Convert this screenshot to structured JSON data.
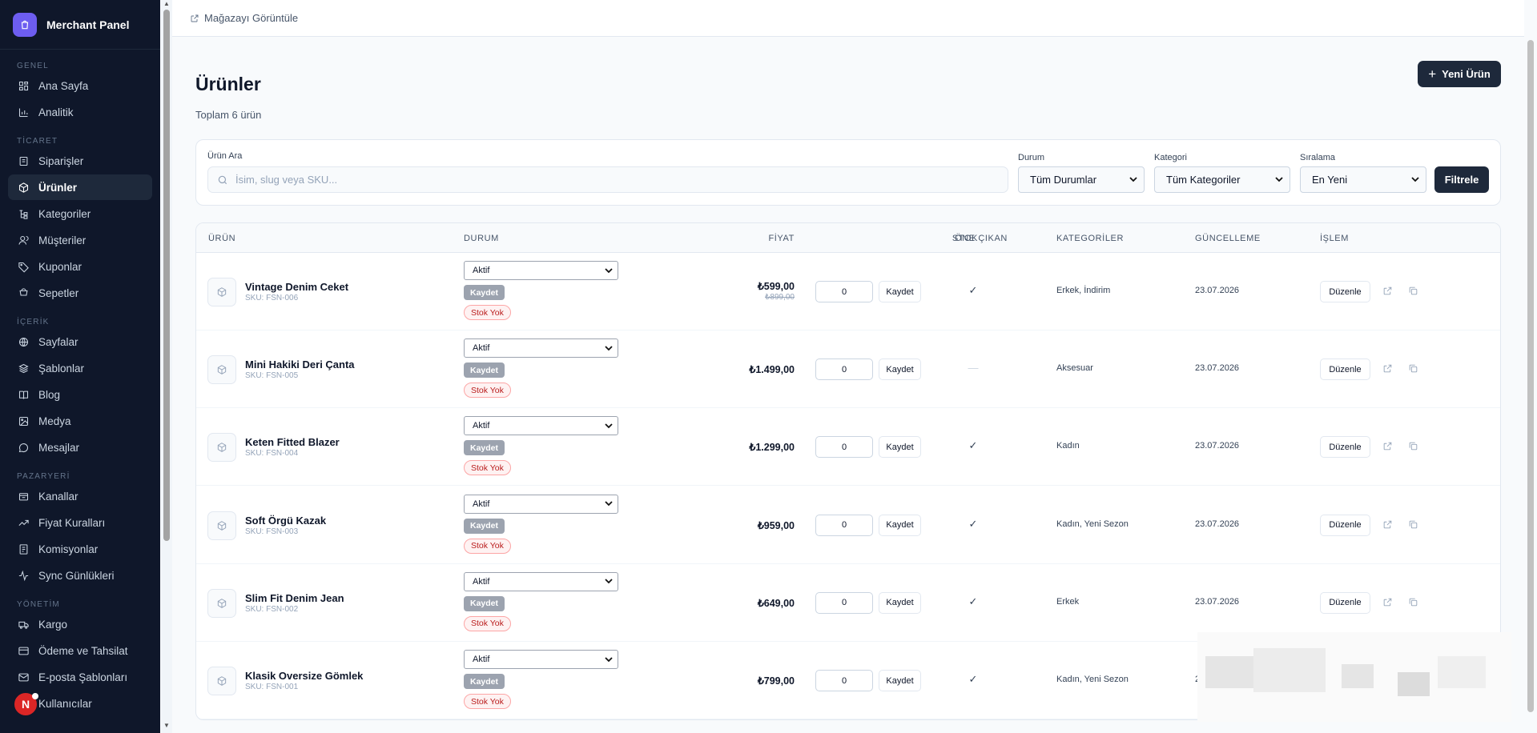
{
  "app": {
    "name": "Merchant Panel"
  },
  "sidebar": {
    "sections": [
      {
        "title": "GENEL",
        "items": [
          {
            "label": "Ana Sayfa",
            "icon": "dashboard-icon"
          },
          {
            "label": "Analitik",
            "icon": "chart-icon"
          }
        ]
      },
      {
        "title": "TİCARET",
        "items": [
          {
            "label": "Siparişler",
            "icon": "orders-icon"
          },
          {
            "label": "Ürünler",
            "icon": "box-icon",
            "active": true
          },
          {
            "label": "Kategoriler",
            "icon": "category-icon"
          },
          {
            "label": "Müşteriler",
            "icon": "users-icon"
          },
          {
            "label": "Kuponlar",
            "icon": "tag-icon"
          },
          {
            "label": "Sepetler",
            "icon": "cart-icon"
          }
        ]
      },
      {
        "title": "İÇERİK",
        "items": [
          {
            "label": "Sayfalar",
            "icon": "globe-icon"
          },
          {
            "label": "Şablonlar",
            "icon": "layers-icon"
          },
          {
            "label": "Blog",
            "icon": "book-icon"
          },
          {
            "label": "Medya",
            "icon": "image-icon"
          },
          {
            "label": "Mesajlar",
            "icon": "message-icon"
          }
        ]
      },
      {
        "title": "PAZARYERİ",
        "items": [
          {
            "label": "Kanallar",
            "icon": "store-icon"
          },
          {
            "label": "Fiyat Kuralları",
            "icon": "trend-icon"
          },
          {
            "label": "Komisyonlar",
            "icon": "receipt-icon"
          },
          {
            "label": "Sync Günlükleri",
            "icon": "activity-icon"
          }
        ]
      },
      {
        "title": "YÖNETİM",
        "items": [
          {
            "label": "Kargo",
            "icon": "truck-icon"
          },
          {
            "label": "Ödeme ve Tahsilat",
            "icon": "card-icon"
          },
          {
            "label": "E-posta Şablonları",
            "icon": "mail-icon"
          },
          {
            "label": "Kullanıcılar",
            "icon": "user-cog-icon"
          }
        ]
      }
    ],
    "avatar_initial": "N"
  },
  "topbar": {
    "store_link": "Mağazayı Görüntüle"
  },
  "header": {
    "title": "Ürünler",
    "subtitle": "Toplam 6 ürün",
    "new_button": "Yeni Ürün"
  },
  "filters": {
    "search_label": "Ürün Ara",
    "search_placeholder": "İsim, slug veya SKU...",
    "status_label": "Durum",
    "status_value": "Tüm Durumlar",
    "category_label": "Kategori",
    "category_value": "Tüm Kategoriler",
    "sort_label": "Sıralama",
    "sort_value": "En Yeni",
    "filter_button": "Filtrele"
  },
  "table": {
    "columns": {
      "product": "ÜRÜN",
      "status": "DURUM",
      "price": "FİYAT",
      "stock": "STOK",
      "featured": "ÖNE ÇIKAN",
      "categories": "KATEGORİLER",
      "updated": "GÜNCELLEME",
      "action": "İŞLEM"
    },
    "save_label": "Kaydet",
    "out_of_stock_label": "Stok Yok",
    "edit_label": "Düzenle",
    "rows": [
      {
        "name": "Vintage Denim Ceket",
        "sku": "SKU: FSN-006",
        "status": "Aktif",
        "price": "₺599,00",
        "old_price": "₺899,00",
        "stock": "0",
        "featured": "✓",
        "categories": "Erkek, İndirim",
        "updated": "23.07.2026"
      },
      {
        "name": "Mini Hakiki Deri Çanta",
        "sku": "SKU: FSN-005",
        "status": "Aktif",
        "price": "₺1.499,00",
        "old_price": "",
        "stock": "0",
        "featured": "—",
        "categories": "Aksesuar",
        "updated": "23.07.2026"
      },
      {
        "name": "Keten Fitted Blazer",
        "sku": "SKU: FSN-004",
        "status": "Aktif",
        "price": "₺1.299,00",
        "old_price": "",
        "stock": "0",
        "featured": "✓",
        "categories": "Kadın",
        "updated": "23.07.2026"
      },
      {
        "name": "Soft Örgü Kazak",
        "sku": "SKU: FSN-003",
        "status": "Aktif",
        "price": "₺959,00",
        "old_price": "",
        "stock": "0",
        "featured": "✓",
        "categories": "Kadın, Yeni Sezon",
        "updated": "23.07.2026"
      },
      {
        "name": "Slim Fit Denim Jean",
        "sku": "SKU: FSN-002",
        "status": "Aktif",
        "price": "₺649,00",
        "old_price": "",
        "stock": "0",
        "featured": "✓",
        "categories": "Erkek",
        "updated": "23.07.2026"
      },
      {
        "name": "Klasik Oversize Gömlek",
        "sku": "SKU: FSN-001",
        "status": "Aktif",
        "price": "₺799,00",
        "old_price": "",
        "stock": "0",
        "featured": "✓",
        "categories": "Kadın, Yeni Sezon",
        "updated": "2"
      }
    ]
  },
  "colors": {
    "sidebar_bg": "#0f172a",
    "primary": "#1e293b",
    "danger": "#b91c1c",
    "brand": "#6d5df0"
  }
}
